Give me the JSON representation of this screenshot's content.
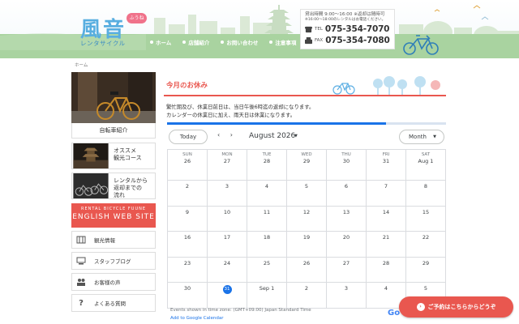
{
  "header": {
    "logo_kanji": "風音",
    "logo_badge": "ふうね",
    "logo_sub": "レンタサイクル",
    "nav": [
      "ホーム",
      "店舗紹介",
      "お問い合わせ",
      "注意事項"
    ],
    "hours_line1": "貸出時間 9:00～16:00 ※返却は随時可",
    "hours_line2": "※16:00～18:00のレンタルはお電話ください。",
    "tel_label": "TEL",
    "tel_number": "075-354-7070",
    "fax_label": "FAX",
    "fax_number": "075-354-7080"
  },
  "breadcrumb": "ホーム",
  "sidebar": {
    "bike_caption": "自転車紹介",
    "cards": [
      {
        "label": "オススメ\n観光コース"
      },
      {
        "label": "レンタルから\n返却までの\n流れ"
      }
    ],
    "english_small": "RENTAL BICYCLE FUUNE",
    "english_big": "ENGLISH WEB SITE",
    "links": [
      "観光情報",
      "スタッフブログ",
      "お客様の声",
      "よくある質問"
    ]
  },
  "main": {
    "title": "今月のお休み",
    "text_line1": "繁忙期及び、休業日前日は、当日午後6時迄の返却になります。",
    "text_line2": "カレンダーの休業日に加え、雨天日は休業になります。"
  },
  "calendar": {
    "today_label": "Today",
    "prev": "‹",
    "next": "›",
    "month_label": "August 2026",
    "view_label": "Month",
    "days_of_week": [
      "SUN",
      "MON",
      "TUE",
      "WED",
      "THU",
      "FRI",
      "SAT"
    ],
    "weeks": [
      [
        "26",
        "27",
        "28",
        "29",
        "30",
        "31",
        "Aug 1"
      ],
      [
        "2",
        "3",
        "4",
        "5",
        "6",
        "7",
        "8"
      ],
      [
        "9",
        "10",
        "11",
        "12",
        "13",
        "14",
        "15"
      ],
      [
        "16",
        "17",
        "18",
        "19",
        "20",
        "21",
        "22"
      ],
      [
        "23",
        "24",
        "25",
        "26",
        "27",
        "28",
        "29"
      ],
      [
        "30",
        "31",
        "Sep 1",
        "2",
        "3",
        "4",
        "5"
      ]
    ],
    "today_value": "31",
    "timezone_text": "Events shown in time zone: (GMT+09:00) Japan Standard Time",
    "add_link": "Add to Google Calendar",
    "google_logo": "Go"
  },
  "reserve_button": "ご予約はこちらからどうぞ",
  "colors": {
    "accent": "#e9574f",
    "logo_blue": "#58aee0",
    "google_blue": "#1a73e8"
  }
}
